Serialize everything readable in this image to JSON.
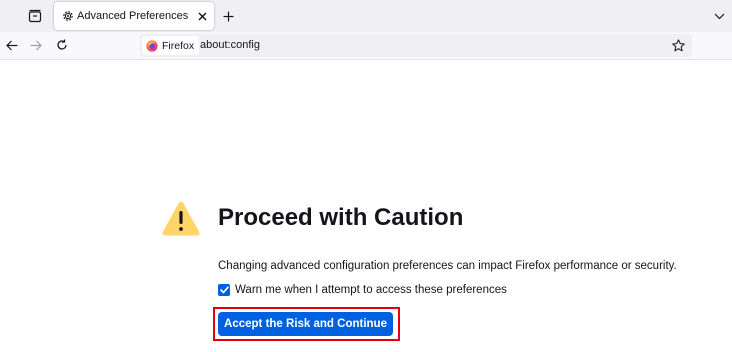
{
  "browser": {
    "tab": {
      "title": "Advanced Preferences",
      "icon": "gear-icon"
    },
    "toolbar_icons": {
      "list_tabs": "tab-list-icon",
      "new_tab": "plus-icon",
      "back": "back-arrow-icon",
      "forward": "forward-arrow-icon",
      "reload": "reload-icon",
      "bookmark": "star-icon",
      "tabs_menu": "chevron-down-icon"
    },
    "urlbar": {
      "identity_label": "Firefox",
      "url": "about:config"
    }
  },
  "page": {
    "title": "Proceed with Caution",
    "description": "Changing advanced configuration preferences can impact Firefox performance or security.",
    "warn_checkbox": {
      "label": "Warn me when I attempt to access these preferences",
      "checked": true
    },
    "accept_button_label": "Accept the Risk and Continue"
  },
  "colors": {
    "accent_blue": "#0061e0",
    "warning_yellow": "#ffd567",
    "highlight_red": "#e3000f",
    "tabbar_bg": "#f0f0f4",
    "text": "#15141a"
  }
}
